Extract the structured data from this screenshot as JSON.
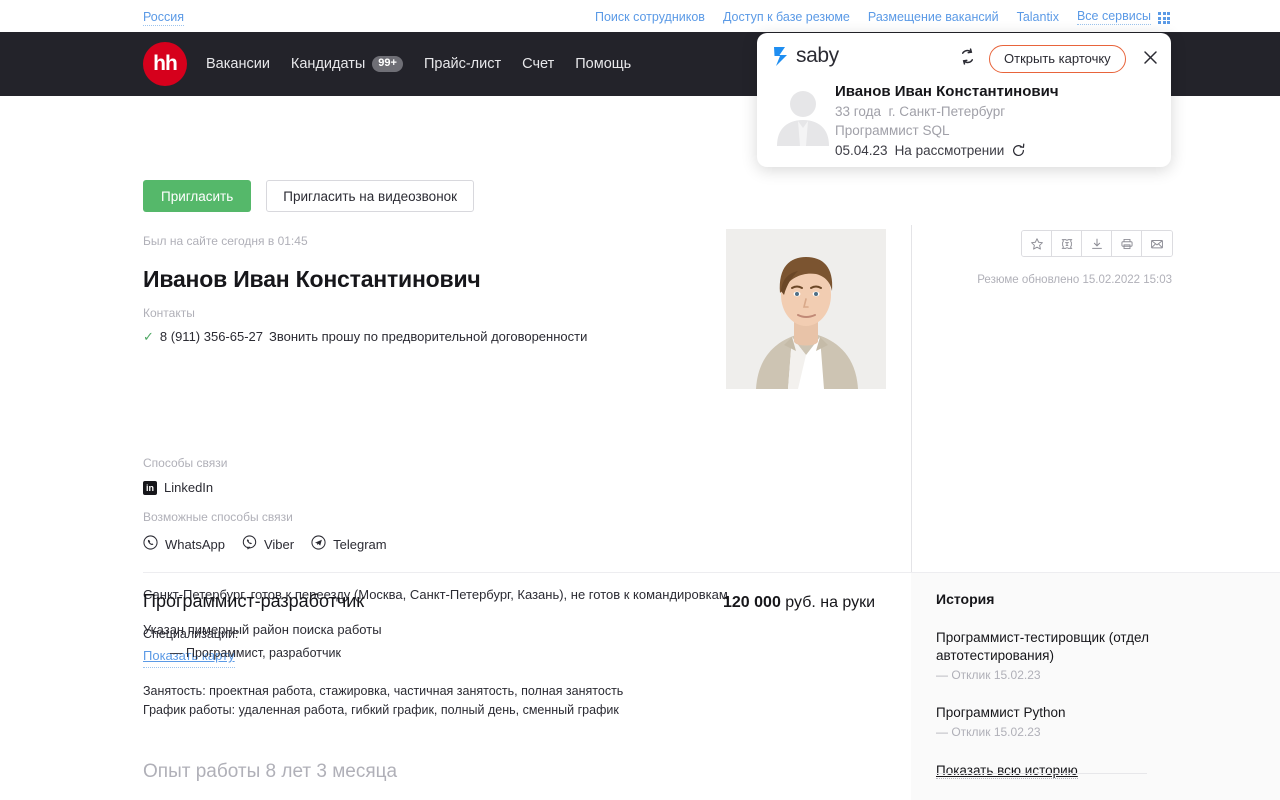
{
  "topbar": {
    "region": "Россия",
    "links": [
      {
        "label": "Поиск сотрудников"
      },
      {
        "label": "Доступ к базе резюме"
      },
      {
        "label": "Размещение вакансий"
      },
      {
        "label": "Talantix"
      },
      {
        "label": "Все сервисы"
      }
    ],
    "apps_icon": "grid-apps-icon"
  },
  "nav": {
    "logo_text": "hh",
    "items": [
      {
        "label": "Вакансии",
        "badge": ""
      },
      {
        "label": "Кандидаты",
        "badge": "99+"
      },
      {
        "label": "Прайс-лист",
        "badge": ""
      },
      {
        "label": "Счет",
        "badge": ""
      },
      {
        "label": "Помощь",
        "badge": ""
      }
    ]
  },
  "saby": {
    "brand": "saby",
    "sync_icon": "sync-icon",
    "open_card_label": "Открыть карточку",
    "close_icon": "close-icon",
    "avatar": "person-placeholder-avatar",
    "name": "Иванов Иван Константинович",
    "age": "33 года",
    "city": "г. Санкт-Петербург",
    "position": "Программист SQL",
    "date": "05.04.23",
    "status": "На рассмотрении",
    "status_icon": "refresh-status-icon",
    "accent_color": "#e8643b",
    "logo_color": "#1f8ef1"
  },
  "actions": {
    "invite": "Пригласить",
    "invite_videocall": "Пригласить на видеозвонок",
    "primary_color": "#55b86a"
  },
  "candidate": {
    "last_visit": "Был на сайте сегодня в 01:45",
    "full_name": "Иванов Иван Константинович",
    "contacts_label": "Контакты",
    "phone": "8 (911) 356-65-27",
    "phone_note": "Звонить прошу по предворительной договоренности",
    "verified_icon": "check-icon",
    "ways_label": "Способы связи",
    "ways": [
      {
        "label": "LinkedIn",
        "icon": "linkedin-icon"
      }
    ],
    "possible_label": "Возможные способы связи",
    "possible": [
      {
        "label": "WhatsApp",
        "icon": "whatsapp-icon"
      },
      {
        "label": "Viber",
        "icon": "viber-icon"
      },
      {
        "label": "Telegram",
        "icon": "telegram-icon"
      }
    ],
    "location": "Санкт-Петербург, готов к переезду (Москва, Санкт-Петербург, Казань), не готов к командировкам",
    "area_note": "Указан пимерный район поиска работы",
    "map_link": "Показать карту",
    "photo_alt": "Фото кандидата"
  },
  "resume_tools": {
    "updated": "Резюме обновлено 15.02.2022 15:03",
    "buttons": [
      {
        "icon": "star-icon"
      },
      {
        "icon": "edit-text-icon"
      },
      {
        "icon": "download-icon"
      },
      {
        "icon": "print-icon"
      },
      {
        "icon": "mail-icon"
      }
    ]
  },
  "job": {
    "title": "Программист-разработчик",
    "salary_amount": "120 000",
    "salary_suffix": " руб. на руки",
    "spec_label": "Специализации:",
    "spec_items": [
      "— Программист, разработчик"
    ],
    "employment": "Занятость: проектная работа, стажировка, частичная занятость, полная занятость",
    "schedule": "График работы: удаленная работа, гибкий график, полный день, сменный график",
    "experience_heading": "Опыт работы 8 лет 3 месяца"
  },
  "history": {
    "title": "История",
    "items": [
      {
        "name": "Программист-тестировщик (отдел автотестирования)",
        "sub": "— Отклик 15.02.23"
      },
      {
        "name": "Программист Python",
        "sub": "— Отклик 15.02.23"
      }
    ],
    "show_all": "Показать всю историю"
  }
}
